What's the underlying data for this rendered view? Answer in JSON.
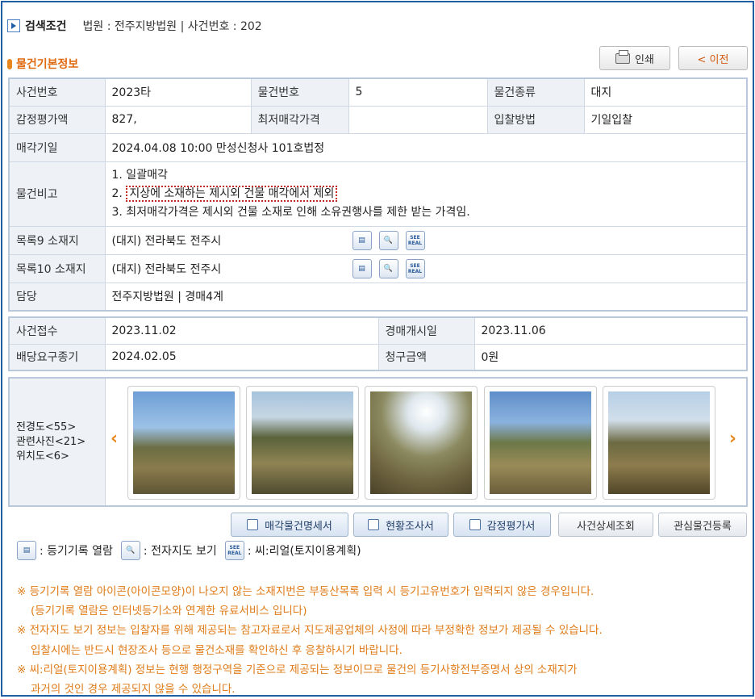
{
  "search": {
    "label": "검색조건",
    "value": "법원 : 전주지방법원 | 사건번호 : 202"
  },
  "section_title": "물건기본정보",
  "buttons": {
    "print": "인쇄",
    "back": "< 이전"
  },
  "basic": {
    "case_no_label": "사건번호",
    "case_no": "2023타",
    "item_no_label": "물건번호",
    "item_no": "5",
    "item_type_label": "물건종류",
    "item_type": "대지",
    "appraisal_label": "감정평가액",
    "appraisal": "827,",
    "min_price_label": "최저매각가격",
    "min_price": "",
    "bid_method_label": "입찰방법",
    "bid_method": "기일입찰",
    "sale_date_label": "매각기일",
    "sale_date": "2024.04.08 10:00 만성신청사 101호법정",
    "remarks_label": "물건비고",
    "remark1": "1. 일괄매각",
    "remark2_prefix": "2. ",
    "remark2": "지상에 소재하는 제시외 건물 매각에서 제외",
    "remark3": "3. 최저매각가격은 제시외 건물 소재로 인해 소유권행사를 제한 받는 가격임.",
    "addr9_label": "목록9 소재지",
    "addr9": "(대지) 전라북도 전주시",
    "addr10_label": "목록10 소재지",
    "addr10": "(대지) 전라북도 전주시",
    "charge_label": "담당",
    "charge": "전주지방법원 | 경매4계"
  },
  "case": {
    "received_label": "사건접수",
    "received": "2023.11.02",
    "start_label": "경매개시일",
    "start": "2023.11.06",
    "deadline_label": "배당요구종기",
    "deadline": "2024.02.05",
    "claim_label": "청구금액",
    "claim": "0원"
  },
  "photos": {
    "overview": "전경도<55>",
    "related": "관련사진<21>",
    "location": "위치도<6>"
  },
  "actions": {
    "sale_spec": "매각물건명세서",
    "survey": "현황조사서",
    "appraisal": "감정평가서",
    "case_detail": "사건상세조회",
    "watch": "관심물건등록"
  },
  "legend": {
    "registry": ": 등기기록 열람",
    "map": ": 전자지도 보기",
    "seereal": ": 씨:리얼(토지이용계획)"
  },
  "icons": {
    "registry": "registry-icon",
    "map": "map-magnifier-icon",
    "seereal": "seereal-icon",
    "seereal_text": "SEE REAL"
  },
  "notes": {
    "n1": "※ 등기기록 열람 아이콘(아이콘모양)이 나오지 않는 소재지번은 부동산목록 입력 시 등기고유번호가 입력되지 않은 경우입니다.",
    "n1b": "(등기기록 열람은 인터넷등기소와 연계한 유료서비스 입니다)",
    "n2": "※ 전자지도 보기 정보는 입찰자를 위해 제공되는 참고자료로서 지도제공업체의 사정에 따라 부정확한 정보가 제공될 수 있습니다.",
    "n2b": "입찰시에는 반드시 현장조사 등으로 물건소재를 확인하신 후 응찰하시기 바랍니다.",
    "n3": "※ 씨:리얼(토지이용계획) 정보는 현행 행정구역을 기준으로 제공되는 정보이므로 물건의 등기사항전부증명서 상의 소재지가",
    "n3b": "과거의 것인 경우 제공되지 않을 수 있습니다."
  },
  "colors": {
    "accent": "#e8871e",
    "frame": "#1f5fa6",
    "note": "#e07b18",
    "highlight": "#c62828"
  }
}
